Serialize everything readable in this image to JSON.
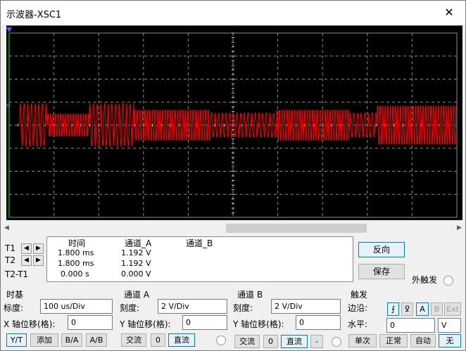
{
  "window": {
    "title": "示波器-XSC1",
    "close_glyph": "✕"
  },
  "readout": {
    "col_time": "时间",
    "col_a": "通道_A",
    "col_b": "通道_B",
    "t1_label": "T1",
    "t2_label": "T2",
    "t2t1_label": "T2-T1",
    "t1_time": "1.800 ms",
    "t1_a": "1.192 V",
    "t2_time": "1.800 ms",
    "t2_a": "1.192 V",
    "d_time": "0.000 s",
    "d_a": "0.000 V"
  },
  "buttons": {
    "reverse": "反向",
    "save": "保存",
    "ext_trigger": "外触发"
  },
  "timebase": {
    "title": "时基",
    "scale_label": "标度:",
    "scale_value": "100 us/Div",
    "xpos_label": "X 轴位移(格):",
    "xpos_value": "0",
    "mode_yt": "Y/T",
    "mode_add": "添加",
    "mode_ba": "B/A",
    "mode_ab": "A/B"
  },
  "channel_a": {
    "title": "通道 A",
    "scale_label": "刻度:",
    "scale_value": "2  V/Div",
    "ypos_label": "Y 轴位移(格):",
    "ypos_value": "0",
    "ac": "交流",
    "zero": "0",
    "dc": "直流"
  },
  "channel_b": {
    "title": "通道 B",
    "scale_label": "刻度:",
    "scale_value": "2  V/Div",
    "ypos_label": "Y 轴位移(格):",
    "ypos_value": "0",
    "ac": "交流",
    "zero": "0",
    "dc": "直流",
    "minus": "-"
  },
  "trigger": {
    "title": "触发",
    "edge_label": "边沿:",
    "edge_rise": "⨍",
    "edge_fall": "ꝿ",
    "src_a": "A",
    "src_b": "B",
    "src_ext": "Ext",
    "level_label": "水平:",
    "level_value": "0",
    "level_unit": "V",
    "single": "单次",
    "normal": "正常",
    "auto": "自动",
    "none": "无"
  },
  "colors": {
    "trace": "#ff0000",
    "grid": "#8c8c8c",
    "screen_bg": "#000000",
    "cursor1": "#00ff00"
  },
  "waveform": {
    "description_units": "divisions",
    "burst_segments_div": [
      [
        0.3,
        1.1
      ],
      [
        1.1,
        2.3
      ],
      [
        2.3,
        3.6
      ],
      [
        3.6,
        5.8
      ],
      [
        5.8,
        7.7
      ],
      [
        7.7,
        9.8
      ],
      [
        9.8,
        10.6
      ],
      [
        10.6,
        12.9
      ]
    ],
    "segment_amplitude_div": [
      0.95,
      0.55,
      0.95,
      0.75,
      0.55,
      0.75,
      0.55,
      0.95
    ]
  }
}
